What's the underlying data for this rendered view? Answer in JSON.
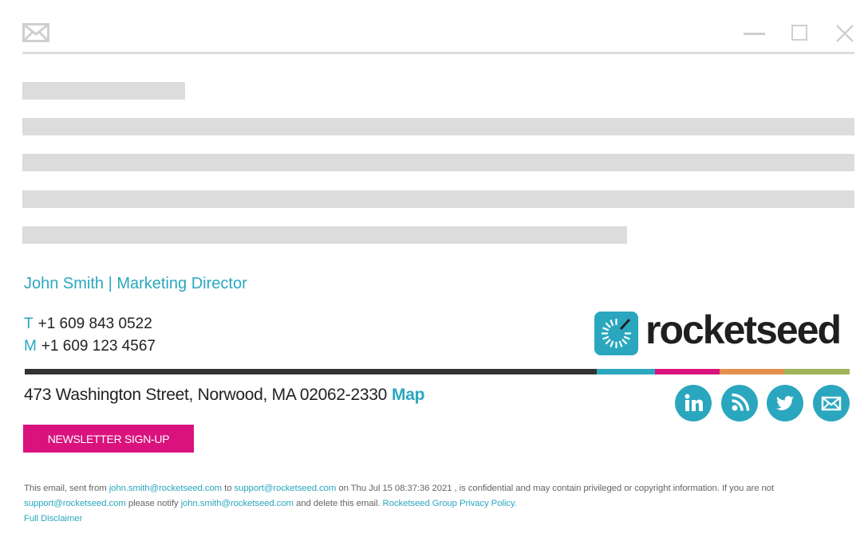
{
  "window": {
    "icons": {
      "mail": "envelope-icon",
      "minimize": "minimize-icon",
      "maximize": "maximize-icon",
      "close": "close-icon"
    }
  },
  "signature": {
    "name_title": "John Smith | Marketing Director",
    "phone_label": "T",
    "phone": "+1 609 843 0522",
    "mobile_label": "M",
    "mobile": "+1 609 123 4567",
    "logo_text": "rocketseed",
    "address": "473 Washington Street, Norwood, MA 02062-2330",
    "map_link": "Map",
    "newsletter_button": "NEWSLETTER SIGN-UP",
    "social": [
      "linkedin-icon",
      "rss-icon",
      "twitter-icon",
      "email-icon"
    ],
    "bar_colors": [
      "#333333",
      "#2aa7bf",
      "#d9127d",
      "#e3904f",
      "#9eb35a"
    ],
    "accent": "#2aa7bf"
  },
  "disclaimer": {
    "p1": "This email, sent from ",
    "from": "john.smith@rocketseed.com",
    "p2": " to ",
    "to": "support@rocketseed.com",
    "p3": " on Thu Jul 15 08:37:36 2021 , is confidential and may contain privileged or copyright information. If you are not ",
    "to2": "support@rocketseed.com",
    "p4": " please notify ",
    "from2": "john.smith@rocketseed.com",
    "p5": " and delete this email. ",
    "privacy": "Rocketseed Group Privacy Policy.",
    "full": "Full Disclaimer"
  }
}
